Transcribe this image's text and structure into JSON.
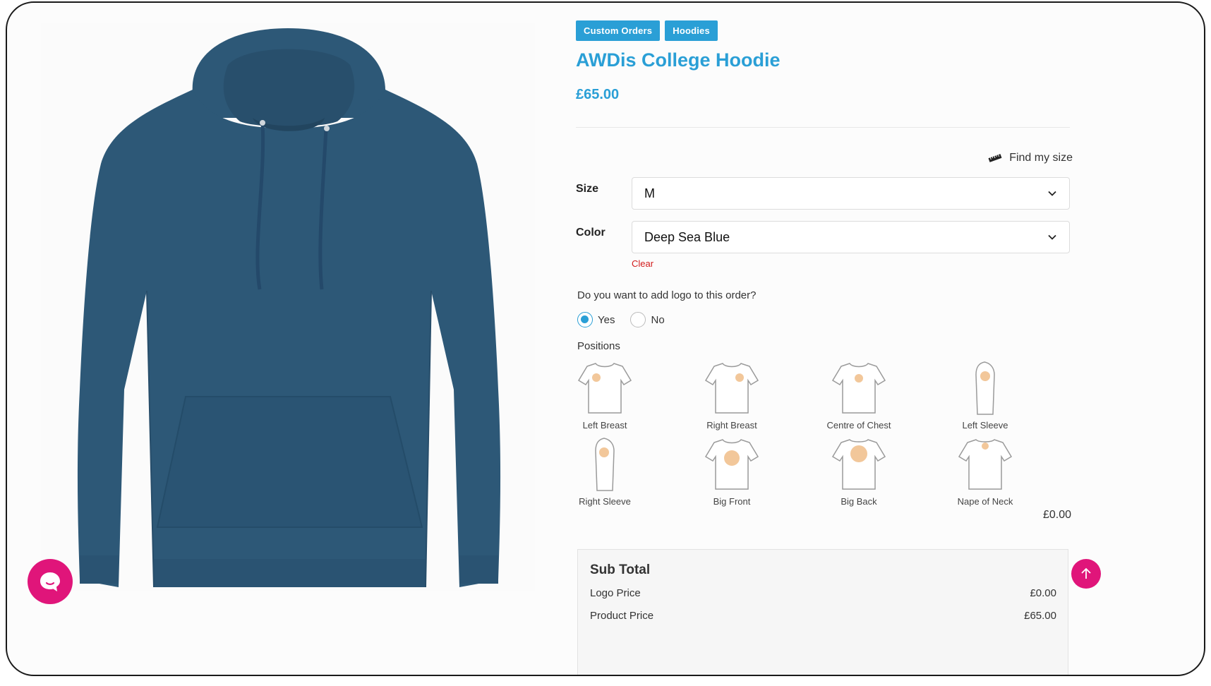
{
  "product": {
    "tags": [
      "Custom Orders",
      "Hoodies"
    ],
    "title": "AWDis College Hoodie",
    "price": "£65.00",
    "image_color": "#2d5877"
  },
  "find_size": {
    "label": "Find my size",
    "icon": "ruler-icon"
  },
  "size": {
    "label": "Size",
    "value": "M"
  },
  "color": {
    "label": "Color",
    "value": "Deep Sea Blue",
    "clear_label": "Clear"
  },
  "logo": {
    "question": "Do you want to add logo to this order?",
    "options": [
      {
        "label": "Yes",
        "checked": true
      },
      {
        "label": "No",
        "checked": false
      }
    ]
  },
  "positions": {
    "label": "Positions",
    "items": [
      {
        "label": "Left Breast",
        "icon": "tshirt-left-breast-icon"
      },
      {
        "label": "Right Breast",
        "icon": "tshirt-right-breast-icon"
      },
      {
        "label": "Centre of Chest",
        "icon": "tshirt-centre-chest-icon"
      },
      {
        "label": "Left Sleeve",
        "icon": "tshirt-left-sleeve-icon"
      },
      {
        "label": "Right Sleeve",
        "icon": "tshirt-right-sleeve-icon"
      },
      {
        "label": "Big Front",
        "icon": "tshirt-big-front-icon"
      },
      {
        "label": "Big Back",
        "icon": "tshirt-big-back-icon"
      },
      {
        "label": "Nape of Neck",
        "icon": "tshirt-nape-neck-icon"
      }
    ],
    "total": "£0.00"
  },
  "subtotal": {
    "title": "Sub Total",
    "rows": [
      {
        "label": "Logo Price",
        "value": "£0.00"
      },
      {
        "label": "Product Price",
        "value": "£65.00"
      }
    ]
  },
  "colors": {
    "accent": "#2a9fd6",
    "danger": "#d21b1b",
    "chat": "#e0157a"
  },
  "widgets": {
    "chat_icon": "chat-bubble-icon",
    "top_icon": "arrow-up-icon"
  }
}
